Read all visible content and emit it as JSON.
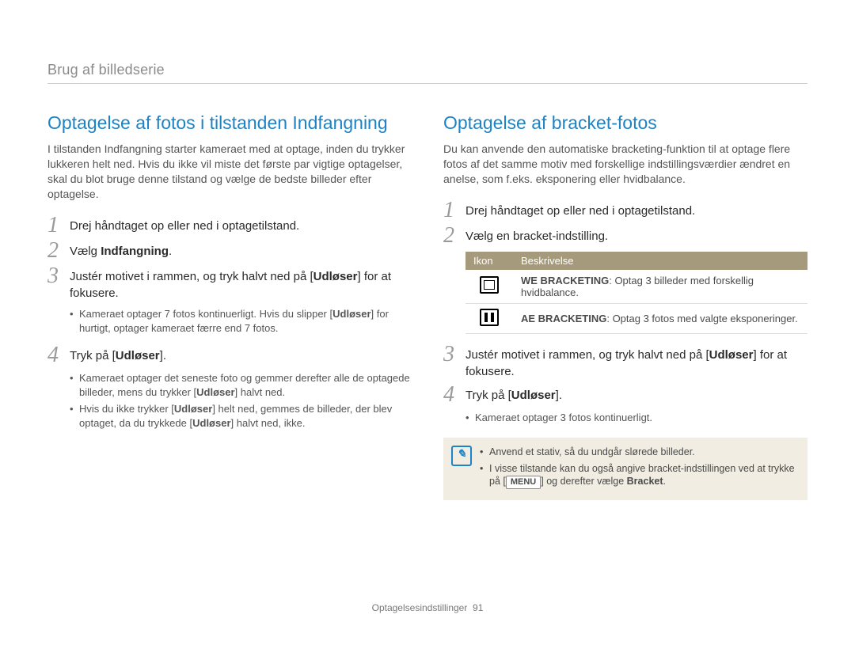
{
  "breadcrumb": "Brug af billedserie",
  "left": {
    "heading": "Optagelse af fotos i tilstanden Indfangning",
    "intro": "I tilstanden Indfangning starter kameraet med at optage, inden du trykker lukkeren helt ned. Hvis du ikke vil miste det første par vigtige optagelser, skal du blot bruge denne tilstand og vælge de bedste billeder efter optagelse.",
    "step1": "Drej håndtaget op eller ned i optagetilstand.",
    "step2_pre": "Vælg ",
    "step2_bold": "Indfangning",
    "step2_post": ".",
    "step3_pre": "Justér motivet i rammen, og tryk halvt ned på [",
    "step3_bold": "Udløser",
    "step3_post": "] for at fokusere.",
    "step3_b1_pre": "Kameraet optager 7 fotos kontinuerligt. Hvis du slipper [",
    "step3_b1_bold": "Udløser",
    "step3_b1_post": "] for hurtigt, optager kameraet færre end 7 fotos.",
    "step4_pre": "Tryk på [",
    "step4_bold": "Udløser",
    "step4_post": "].",
    "step4_b1_pre": "Kameraet optager det seneste foto og gemmer derefter alle de optagede billeder, mens du trykker [",
    "step4_b1_bold": "Udløser",
    "step4_b1_post": "] halvt ned.",
    "step4_b2_pre": "Hvis du ikke trykker [",
    "step4_b2_bold1": "Udløser",
    "step4_b2_mid": "] helt ned, gemmes de billeder, der blev optaget, da du trykkede [",
    "step4_b2_bold2": "Udløser",
    "step4_b2_post": "] halvt ned, ikke."
  },
  "right": {
    "heading": "Optagelse af bracket-fotos",
    "intro": "Du kan anvende den automatiske bracketing-funktion til at optage flere fotos af det samme motiv med forskellige indstillingsværdier ændret en anelse, som f.eks. eksponering eller hvidbalance.",
    "step1": "Drej håndtaget op eller ned i optagetilstand.",
    "step2": "Vælg en bracket-indstilling.",
    "table": {
      "th_icon": "Ikon",
      "th_desc": "Beskrivelse",
      "row1_bold": "WE BRACKETING",
      "row1_rest": ": Optag 3 billeder med forskellig hvidbalance.",
      "row2_bold": "AE BRACKETING",
      "row2_rest": ": Optag 3 fotos med valgte eksponeringer."
    },
    "step3_pre": "Justér motivet i rammen, og tryk halvt ned på [",
    "step3_bold": "Udløser",
    "step3_post": "] for at fokusere.",
    "step4_pre": "Tryk på [",
    "step4_bold": "Udløser",
    "step4_post": "].",
    "step4_b1": "Kameraet optager 3 fotos kontinuerligt.",
    "note1": "Anvend et stativ, så du undgår slørede billeder.",
    "note2_pre": "I visse tilstande kan du også angive bracket-indstillingen ved at trykke på [",
    "note2_menu": "MENU",
    "note2_mid": "] og derefter vælge ",
    "note2_bold": "Bracket",
    "note2_post": "."
  },
  "footer_label": "Optagelsesindstillinger",
  "footer_page": "91"
}
